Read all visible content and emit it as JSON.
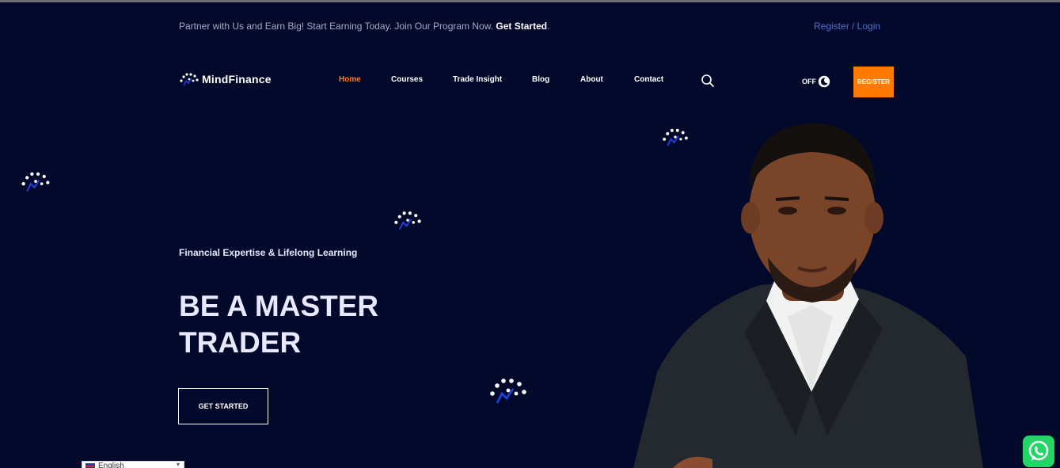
{
  "topbar": {
    "promo_text": "Partner with Us and Earn Big! Start Earning Today. Join Our Program Now.",
    "promo_cta": "Get Started",
    "promo_suffix": ".",
    "auth_text": "Register / Login"
  },
  "header": {
    "logo_text": "MindFinance",
    "nav": [
      "Home",
      "Courses",
      "Trade Insight",
      "Blog",
      "About",
      "Contact"
    ],
    "active_nav": "Home",
    "theme_toggle_label": "OFF",
    "register_label": "REGISTER"
  },
  "hero": {
    "tagline": "Financial Expertise & Lifelong Learning",
    "title": "BE A MASTER TRADER",
    "cta_label": "GET STARTED"
  },
  "language_selector": {
    "selected": "English"
  },
  "colors": {
    "background": "#02092a",
    "accent": "#ff7a00",
    "link": "#4f6fd1",
    "whatsapp": "#25d366"
  },
  "icons": [
    "logo-mark-icon",
    "search-icon",
    "moon-icon",
    "whatsapp-icon",
    "chevron-down-icon",
    "flag-icon"
  ]
}
